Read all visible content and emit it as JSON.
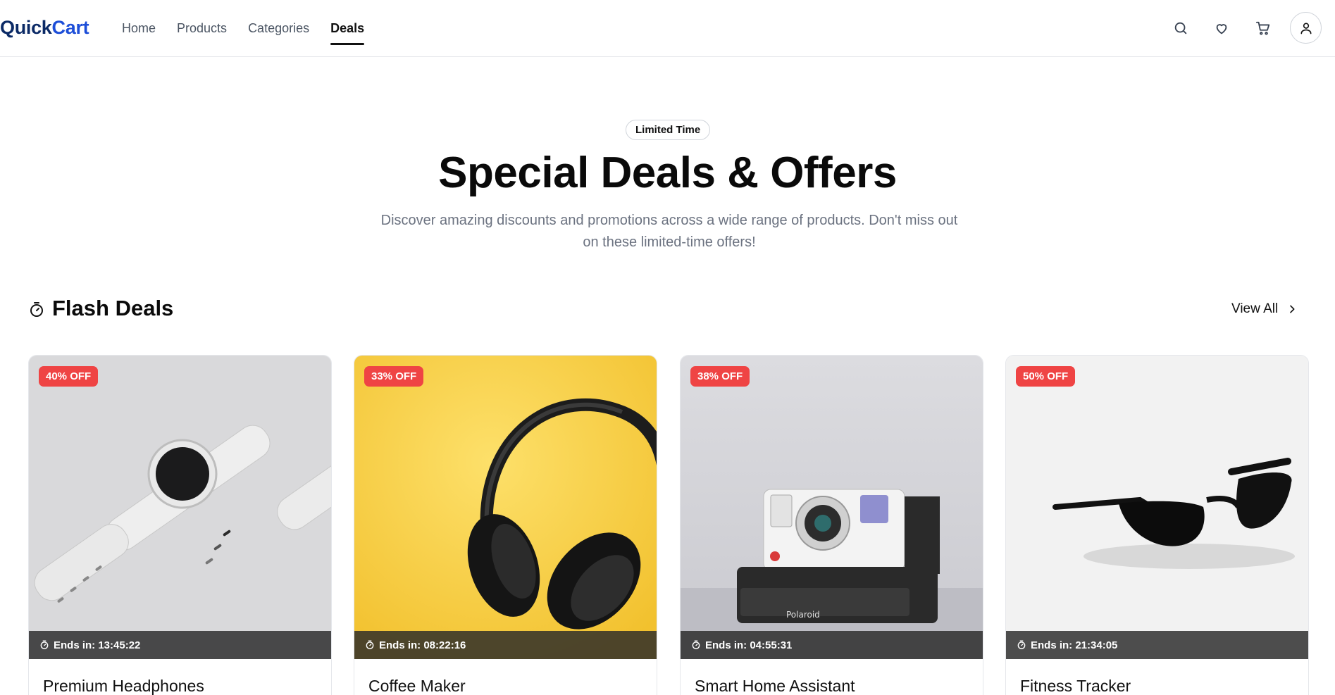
{
  "header": {
    "logo_a": "Quick",
    "logo_b": "Cart",
    "nav": [
      {
        "label": "Home",
        "active": false
      },
      {
        "label": "Products",
        "active": false
      },
      {
        "label": "Categories",
        "active": false
      },
      {
        "label": "Deals",
        "active": true
      }
    ],
    "icons": [
      "search-icon",
      "heart-icon",
      "cart-icon",
      "user-icon"
    ]
  },
  "hero": {
    "pill": "Limited Time",
    "title": "Special Deals & Offers",
    "subtitle": "Discover amazing discounts and promotions across a wide range of products. Don't miss out on these limited-time offers!"
  },
  "section": {
    "title": "Flash Deals",
    "view_all": "View All"
  },
  "products": [
    {
      "name": "Premium Headphones",
      "discount": "40% OFF",
      "timer": "Ends in: 13:45:22",
      "image": "watch"
    },
    {
      "name": "Coffee Maker",
      "discount": "33% OFF",
      "timer": "Ends in: 08:22:16",
      "image": "headphones"
    },
    {
      "name": "Smart Home Assistant",
      "discount": "38% OFF",
      "timer": "Ends in: 04:55:31",
      "image": "camera"
    },
    {
      "name": "Fitness Tracker",
      "discount": "50% OFF",
      "timer": "Ends in: 21:34:05",
      "image": "sunglasses"
    }
  ],
  "colors": {
    "brand": "#0b2a66",
    "accent": "#1d4ed8",
    "badge": "#ef4444"
  }
}
